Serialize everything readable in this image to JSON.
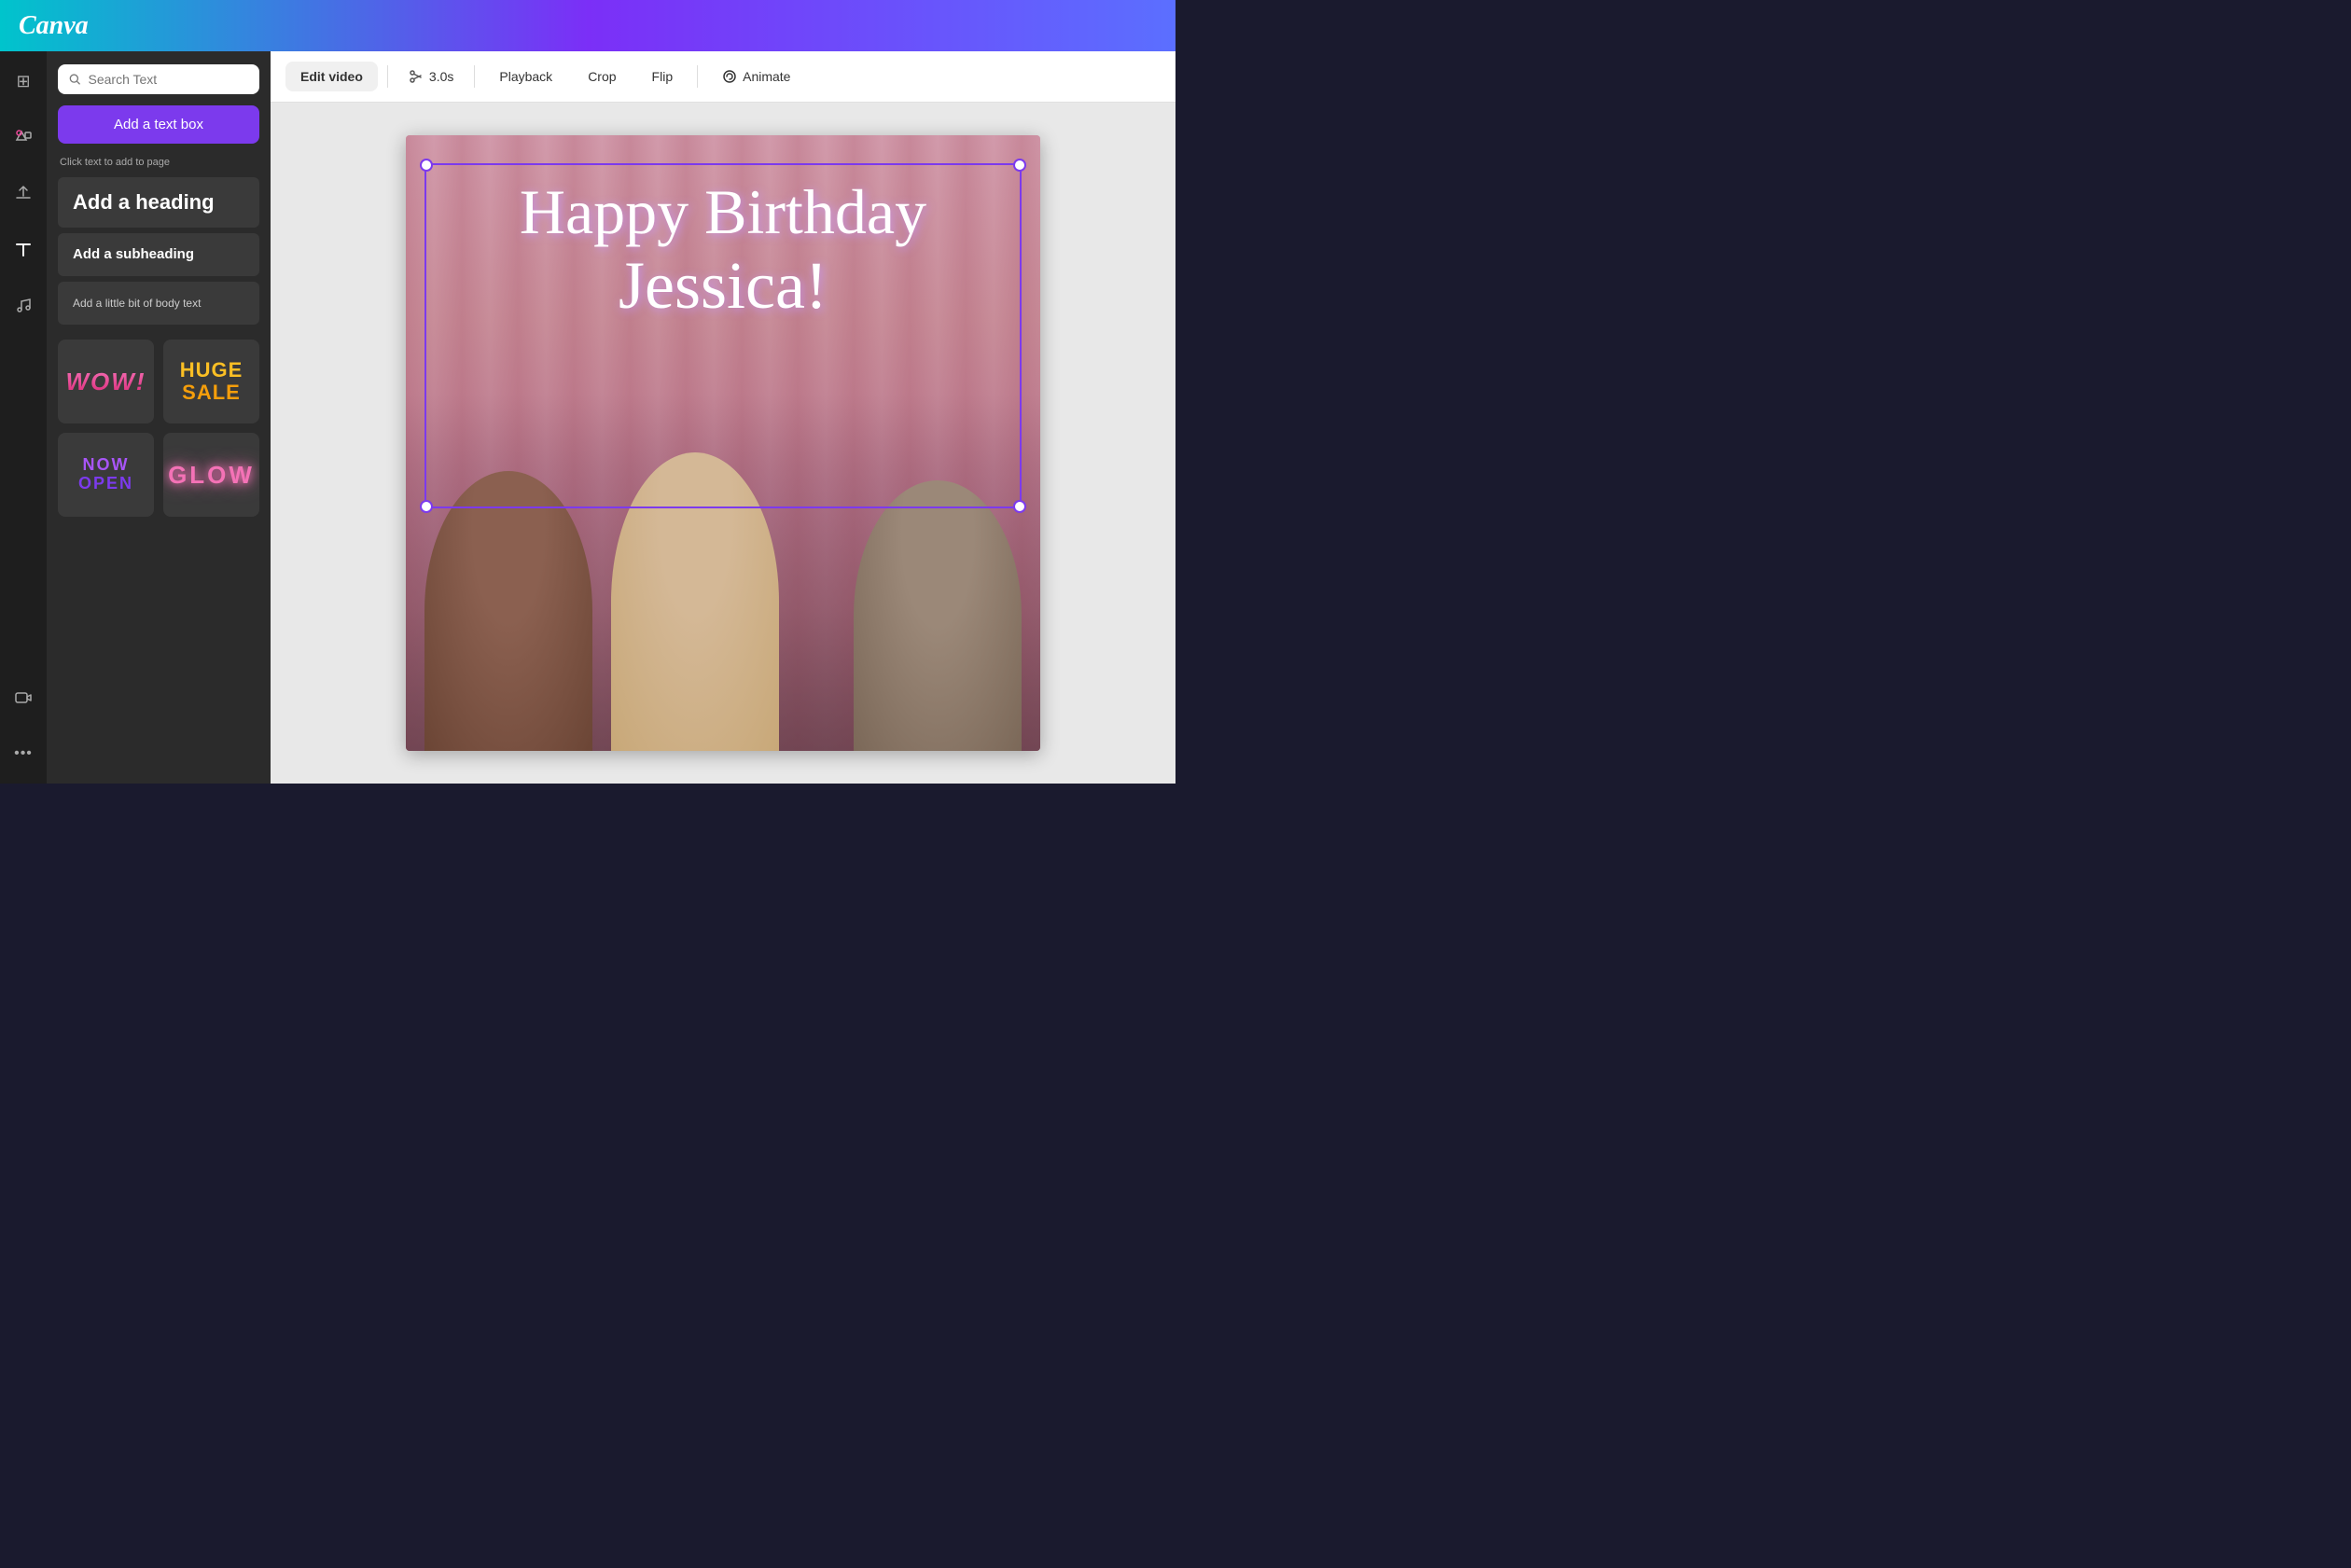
{
  "header": {
    "logo": "Canva"
  },
  "sidebar_icons": [
    {
      "name": "grid-icon",
      "symbol": "⊞",
      "active": false
    },
    {
      "name": "shapes-icon",
      "symbol": "♡△",
      "active": false
    },
    {
      "name": "upload-icon",
      "symbol": "⬆",
      "active": false
    },
    {
      "name": "text-icon",
      "symbol": "T",
      "active": true
    },
    {
      "name": "music-icon",
      "symbol": "♪",
      "active": false
    },
    {
      "name": "video-icon",
      "symbol": "▶",
      "active": false
    },
    {
      "name": "more-icon",
      "symbol": "...",
      "active": false
    }
  ],
  "text_panel": {
    "search_placeholder": "Search Text",
    "add_textbox_label": "Add a text box",
    "instruction": "Click text to add to page",
    "heading_label": "Add a heading",
    "subheading_label": "Add a subheading",
    "body_label": "Add a little bit of body text",
    "style_cards": [
      {
        "name": "wow-card",
        "display": "WOW!"
      },
      {
        "name": "huge-sale-card",
        "display": "HUGE SALE"
      },
      {
        "name": "now-open-card",
        "display": "NOW OPEN"
      },
      {
        "name": "glow-card",
        "display": "GLOW"
      }
    ]
  },
  "toolbar": {
    "edit_video_label": "Edit video",
    "cut_duration": "3.0s",
    "playback_label": "Playback",
    "crop_label": "Crop",
    "flip_label": "Flip",
    "animate_label": "Animate"
  },
  "canvas": {
    "birthday_line1": "Happy Birthday",
    "birthday_line2": "Jessica!"
  }
}
